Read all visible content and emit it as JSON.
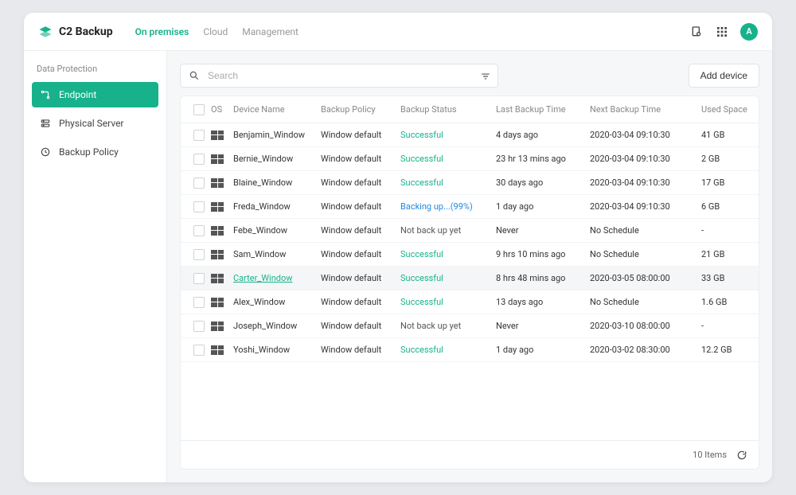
{
  "brand": {
    "name": "C2 Backup"
  },
  "avatar": {
    "initial": "A"
  },
  "topnav": {
    "items": [
      {
        "label": "On premises",
        "active": true
      },
      {
        "label": "Cloud",
        "active": false
      },
      {
        "label": "Management",
        "active": false
      }
    ]
  },
  "sidebar": {
    "section": "Data Protection",
    "items": [
      {
        "label": "Endpoint",
        "icon": "endpoint-icon",
        "active": true
      },
      {
        "label": "Physical Server",
        "icon": "server-icon",
        "active": false
      },
      {
        "label": "Backup Policy",
        "icon": "policy-icon",
        "active": false
      }
    ]
  },
  "search": {
    "placeholder": "Search"
  },
  "buttons": {
    "add_device": "Add device"
  },
  "table": {
    "headers": {
      "os": "OS",
      "device": "Device Name",
      "policy": "Backup Policy",
      "status": "Backup Status",
      "last": "Last Backup Time",
      "next": "Next Backup Time",
      "used": "Used Space"
    },
    "rows": [
      {
        "device": "Benjamin_Window",
        "policy": "Window default",
        "status": "Successful",
        "status_kind": "success",
        "last": "4 days ago",
        "next": "2020-03-04 09:10:30",
        "used": "41 GB",
        "highlight": false
      },
      {
        "device": "Bernie_Window",
        "policy": "Window default",
        "status": "Successful",
        "status_kind": "success",
        "last": "23 hr 13 mins ago",
        "next": "2020-03-04 09:10:30",
        "used": "2 GB",
        "highlight": false
      },
      {
        "device": "Blaine_Window",
        "policy": "Window default",
        "status": "Successful",
        "status_kind": "success",
        "last": "30 days ago",
        "next": "2020-03-04 09:10:30",
        "used": "17 GB",
        "highlight": false
      },
      {
        "device": "Freda_Window",
        "policy": "Window default",
        "status": "Backing up...(99%)",
        "status_kind": "inprogress",
        "last": "1 day ago",
        "next": "2020-03-04 09:10:30",
        "used": "6 GB",
        "highlight": false
      },
      {
        "device": "Febe_Window",
        "policy": "Window default",
        "status": "Not back up yet",
        "status_kind": "na",
        "last": "Never",
        "next": "No Schedule",
        "used": "-",
        "highlight": false
      },
      {
        "device": "Sam_Window",
        "policy": "Window default",
        "status": "Successful",
        "status_kind": "success",
        "last": "9 hrs 10 mins ago",
        "next": "No Schedule",
        "used": "21 GB",
        "highlight": false
      },
      {
        "device": "Carter_Window",
        "policy": "Window default",
        "status": "Successful",
        "status_kind": "success",
        "last": "8 hrs 48 mins ago",
        "next": "2020-03-05 08:00:00",
        "used": "33 GB",
        "highlight": true
      },
      {
        "device": "Alex_Window",
        "policy": "Window default",
        "status": "Successful",
        "status_kind": "success",
        "last": "13 days ago",
        "next": "No Schedule",
        "used": "1.6 GB",
        "highlight": false
      },
      {
        "device": "Joseph_Window",
        "policy": "Window default",
        "status": "Not back up yet",
        "status_kind": "na",
        "last": "Never",
        "next": "2020-03-10 08:00:00",
        "used": "-",
        "highlight": false
      },
      {
        "device": "Yoshi_Window",
        "policy": "Window default",
        "status": "Successful",
        "status_kind": "success",
        "last": "1 day ago",
        "next": "2020-03-02 08:30:00",
        "used": "12.2  GB",
        "highlight": false
      }
    ]
  },
  "footer": {
    "count_label": "10 Items"
  }
}
